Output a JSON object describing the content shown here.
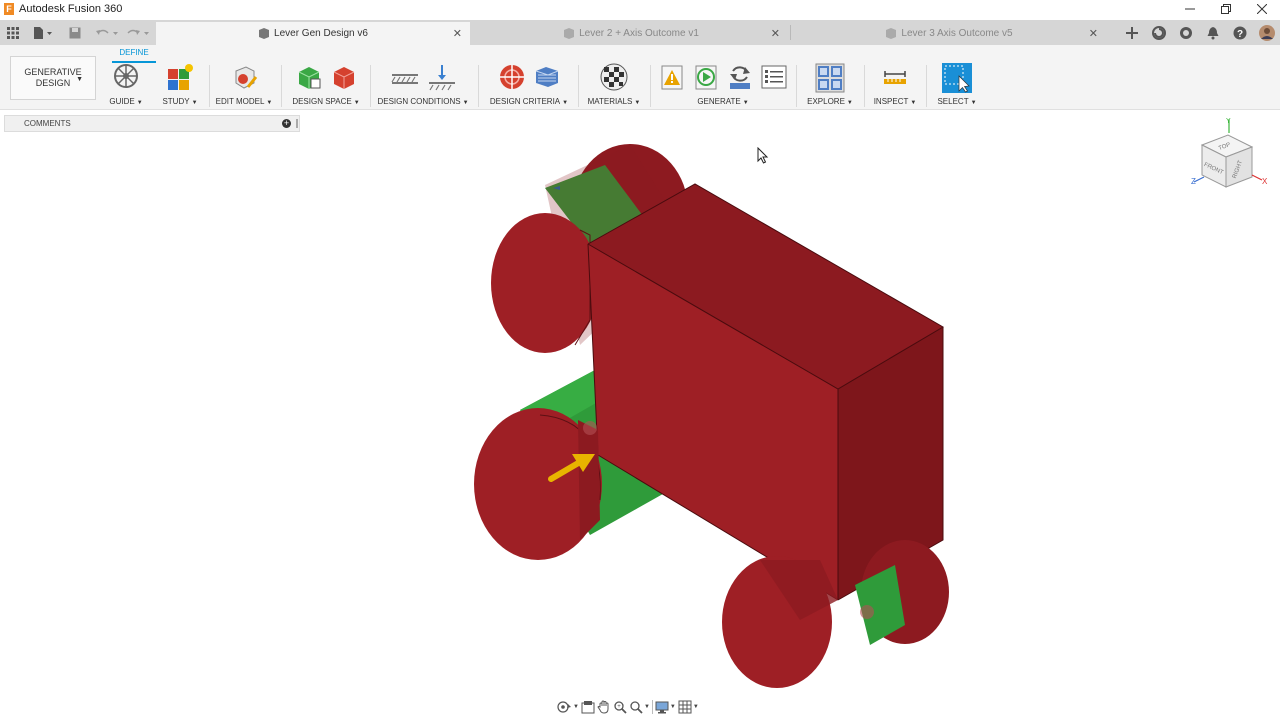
{
  "window": {
    "title": "Autodesk Fusion 360",
    "logo_letter": "F"
  },
  "tabs": [
    {
      "label": "Lever Gen Design v6",
      "active": true
    },
    {
      "label": "Lever 2 + Axis Outcome v1",
      "active": false
    },
    {
      "label": "Lever 3 Axis Outcome v5",
      "active": false
    }
  ],
  "ribbon": {
    "workspace_tab": "DEFINE",
    "workspace_line1": "GENERATIVE",
    "workspace_line2": "DESIGN",
    "groups": [
      {
        "label": "GUIDE",
        "icons": [
          "guide-wheel-icon"
        ]
      },
      {
        "label": "STUDY",
        "icons": [
          "new-study-icon"
        ]
      },
      {
        "label": "EDIT MODEL",
        "icons": [
          "edit-model-icon"
        ]
      },
      {
        "label": "DESIGN SPACE",
        "icons": [
          "preserve-geometry-icon",
          "obstacle-geometry-icon"
        ]
      },
      {
        "label": "DESIGN CONDITIONS",
        "icons": [
          "structural-constraint-icon",
          "structural-load-icon"
        ]
      },
      {
        "label": "DESIGN CRITERIA",
        "icons": [
          "objectives-icon",
          "manufacturing-icon"
        ]
      },
      {
        "label": "MATERIALS",
        "icons": [
          "study-materials-icon"
        ]
      },
      {
        "label": "GENERATE",
        "icons": [
          "pre-check-icon",
          "preview-icon",
          "generate-icon",
          "study-settings-icon"
        ]
      },
      {
        "label": "EXPLORE",
        "icons": [
          "explore-outcomes-icon"
        ]
      },
      {
        "label": "INSPECT",
        "icons": [
          "measure-icon"
        ]
      },
      {
        "label": "SELECT",
        "icons": [
          "select-icon"
        ]
      }
    ]
  },
  "comments": {
    "label": "COMMENTS"
  },
  "viewcube": {
    "face_top": "TOP",
    "face_front": "FRONT",
    "face_right": "RIGHT",
    "axis_x": "X",
    "axis_y": "Y",
    "axis_z": "Z"
  },
  "colors": {
    "accent": "#0696d7",
    "obstacle_red": "#9e1f25",
    "preserve_green": "#2f9b3a",
    "load_arrow": "#e8b400"
  }
}
